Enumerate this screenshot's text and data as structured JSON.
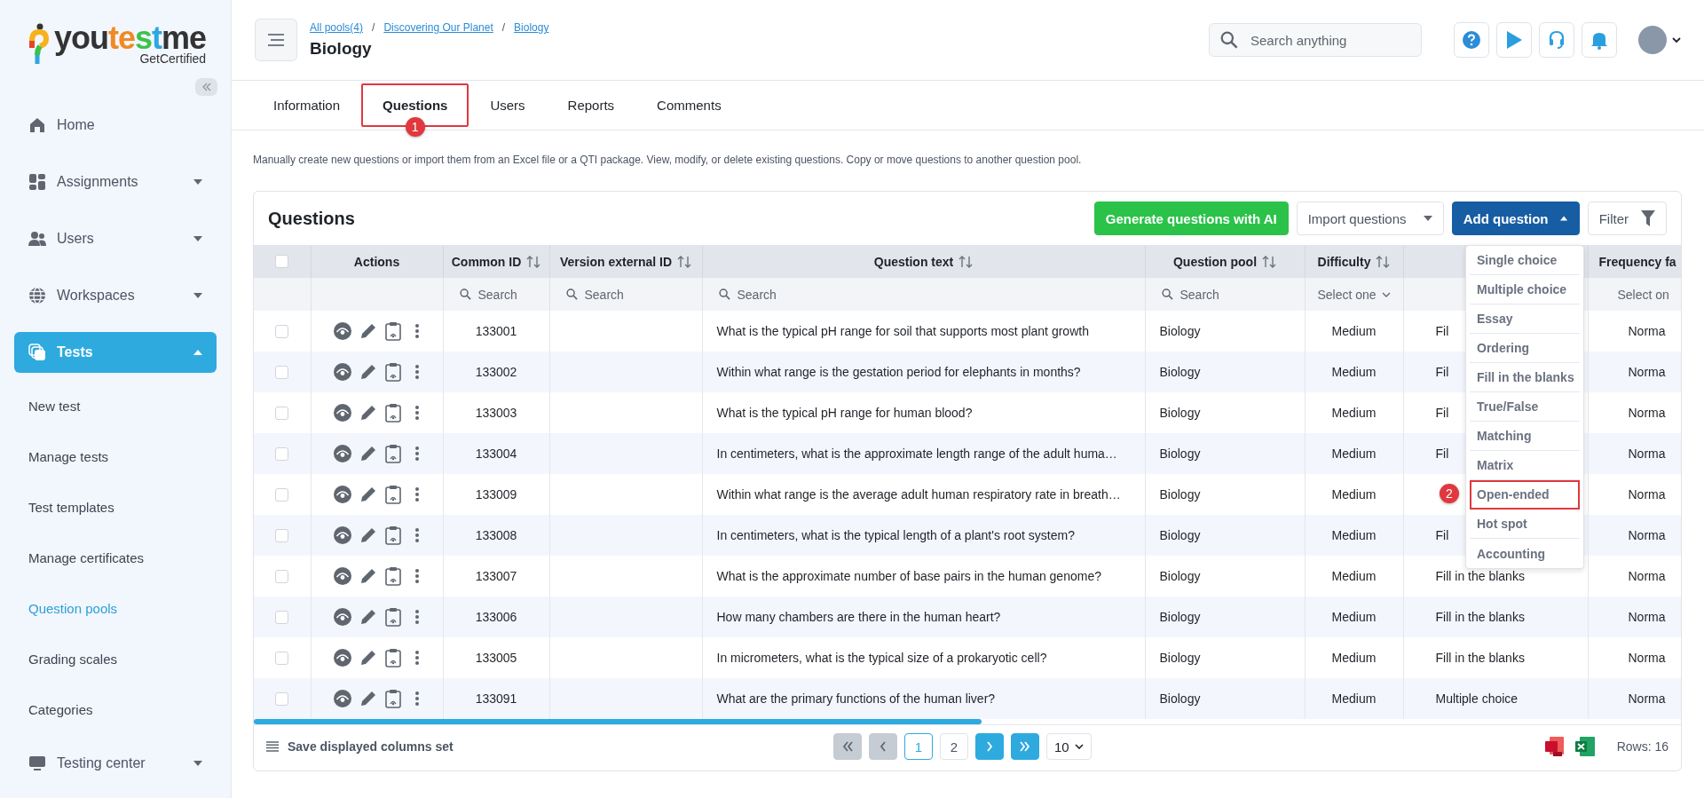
{
  "sidebar": {
    "logo": {
      "parts": [
        "you",
        "te",
        "s",
        "t",
        "me"
      ],
      "tagline": "GetCertified"
    },
    "items": [
      {
        "label": "Home",
        "selected": false
      },
      {
        "label": "Assignments",
        "selected": false,
        "expanded": false
      },
      {
        "label": "Users",
        "selected": false,
        "expanded": false
      },
      {
        "label": "Workspaces",
        "selected": false,
        "expanded": false
      },
      {
        "label": "Tests",
        "selected": true,
        "expanded": true,
        "children": [
          {
            "label": "New test",
            "selected": false
          },
          {
            "label": "Manage tests",
            "selected": false
          },
          {
            "label": "Test templates",
            "selected": false
          },
          {
            "label": "Manage certificates",
            "selected": false
          },
          {
            "label": "Question pools",
            "selected": true
          },
          {
            "label": "Grading scales",
            "selected": false
          },
          {
            "label": "Categories",
            "selected": false
          }
        ]
      },
      {
        "label": "Testing center",
        "selected": false,
        "expanded": false
      }
    ]
  },
  "header": {
    "breadcrumbs": [
      "All pools(4)",
      "/",
      "Discovering Our Planet",
      "/",
      "Biology"
    ],
    "title": "Biology",
    "search": {
      "placeholder": "Search anything"
    }
  },
  "tabs": [
    {
      "label": "Information",
      "selected": false,
      "highlighted": false
    },
    {
      "label": "Questions",
      "selected": true,
      "highlighted": true,
      "marker": "1"
    },
    {
      "label": "Users",
      "selected": false,
      "highlighted": false
    },
    {
      "label": "Reports",
      "selected": false,
      "highlighted": false
    },
    {
      "label": "Comments",
      "selected": false,
      "highlighted": false
    }
  ],
  "description": "Manually create new questions or import them from an Excel file or a QTI package. View, modify, or delete existing questions. Copy or move questions to another question pool.",
  "card": {
    "title": "Questions",
    "buttons": {
      "generate": "Generate questions with AI",
      "import": "Import questions",
      "add": "Add question",
      "filter": "Filter"
    },
    "add_menu": {
      "open": true,
      "items": [
        {
          "label": "Single choice",
          "highlighted": false
        },
        {
          "label": "Multiple choice",
          "highlighted": false
        },
        {
          "label": "Essay",
          "highlighted": false
        },
        {
          "label": "Ordering",
          "highlighted": false
        },
        {
          "label": "Fill in the blanks",
          "highlighted": false
        },
        {
          "label": "True/False",
          "highlighted": false
        },
        {
          "label": "Matching",
          "highlighted": false
        },
        {
          "label": "Matrix",
          "highlighted": false
        },
        {
          "label": "Open-ended",
          "highlighted": true,
          "marker": "2"
        },
        {
          "label": "Hot spot",
          "highlighted": false
        },
        {
          "label": "Accounting",
          "highlighted": false
        }
      ]
    },
    "columns": [
      {
        "kind": "checkbox",
        "checked": false
      },
      {
        "kind": "actions",
        "label": "Actions",
        "sortable": false
      },
      {
        "kind": "center",
        "label": "Common ID",
        "sortable": true,
        "filter": {
          "kind": "search",
          "placeholder": "Search"
        }
      },
      {
        "kind": "center",
        "label": "Version external ID",
        "sortable": true,
        "filter": {
          "kind": "search",
          "placeholder": "Search"
        }
      },
      {
        "kind": "text",
        "label": "Question text",
        "sortable": true,
        "filter": {
          "kind": "search",
          "placeholder": "Search"
        }
      },
      {
        "kind": "text",
        "label": "Question pool",
        "sortable": true,
        "filter": {
          "kind": "search",
          "placeholder": "Search"
        }
      },
      {
        "kind": "center",
        "label": "Difficulty",
        "sortable": true,
        "filter": {
          "kind": "select",
          "placeholder": "Select one"
        }
      },
      {
        "kind": "type"
      },
      {
        "kind": "cut",
        "label": "Frequency fa",
        "filter": {
          "kind": "select",
          "placeholder": "Select on"
        }
      }
    ],
    "rows": [
      {
        "checked": false,
        "common_id": "133001",
        "question_text": "What is the typical pH range for soil that supports most plant growth",
        "question_pool": "Biology",
        "difficulty": "Medium",
        "column_8": "Fil",
        "frequency": "Norma"
      },
      {
        "checked": false,
        "common_id": "133002",
        "question_text": "Within what range is the gestation period for elephants in months?",
        "question_pool": "Biology",
        "difficulty": "Medium",
        "column_8": "Fil",
        "frequency": "Norma"
      },
      {
        "checked": false,
        "common_id": "133003",
        "question_text": "What is the typical pH range for human blood?",
        "question_pool": "Biology",
        "difficulty": "Medium",
        "column_8": "Fil",
        "frequency": "Norma"
      },
      {
        "checked": false,
        "common_id": "133004",
        "question_text": "In centimeters, what is the approximate length range of the adult huma…",
        "question_pool": "Biology",
        "difficulty": "Medium",
        "column_8": "Fil",
        "frequency": "Norma"
      },
      {
        "checked": false,
        "common_id": "133009",
        "question_text": "Within what range is the average adult human respiratory rate in breath…",
        "question_pool": "Biology",
        "difficulty": "Medium",
        "frequency": "Norma"
      },
      {
        "checked": false,
        "common_id": "133008",
        "question_text": "In centimeters, what is the typical length of a plant's root system?",
        "question_pool": "Biology",
        "difficulty": "Medium",
        "column_8": "Fil",
        "frequency": "Norma"
      },
      {
        "checked": false,
        "common_id": "133007",
        "question_text": "What is the approximate number of base pairs in the human genome?",
        "question_pool": "Biology",
        "difficulty": "Medium",
        "column_8": "Fill in the blanks",
        "frequency": "Norma"
      },
      {
        "checked": false,
        "common_id": "133006",
        "question_text": "How many chambers are there in the human heart?",
        "question_pool": "Biology",
        "difficulty": "Medium",
        "column_8": "Fill in the blanks",
        "frequency": "Norma"
      },
      {
        "checked": false,
        "common_id": "133005",
        "question_text": "In micrometers, what is the typical size of a prokaryotic cell?",
        "question_pool": "Biology",
        "difficulty": "Medium",
        "column_8": "Fill in the blanks",
        "frequency": "Norma"
      },
      {
        "checked": false,
        "common_id": "133091",
        "question_text": "What are the primary functions of the human liver?",
        "question_pool": "Biology",
        "difficulty": "Medium",
        "column_8": "Multiple choice",
        "frequency": "Norma"
      }
    ],
    "footer": {
      "save_columns": "Save displayed columns set",
      "pagination": [
        {
          "kind": "first",
          "disabled": true
        },
        {
          "kind": "prev",
          "disabled": true
        },
        {
          "kind": "page",
          "label": "1",
          "selected": true
        },
        {
          "kind": "page",
          "label": "2",
          "selected": false
        },
        {
          "kind": "next",
          "disabled": false
        },
        {
          "kind": "last",
          "disabled": false
        }
      ],
      "page_size": "10",
      "rows_count": "Rows: 16"
    }
  }
}
